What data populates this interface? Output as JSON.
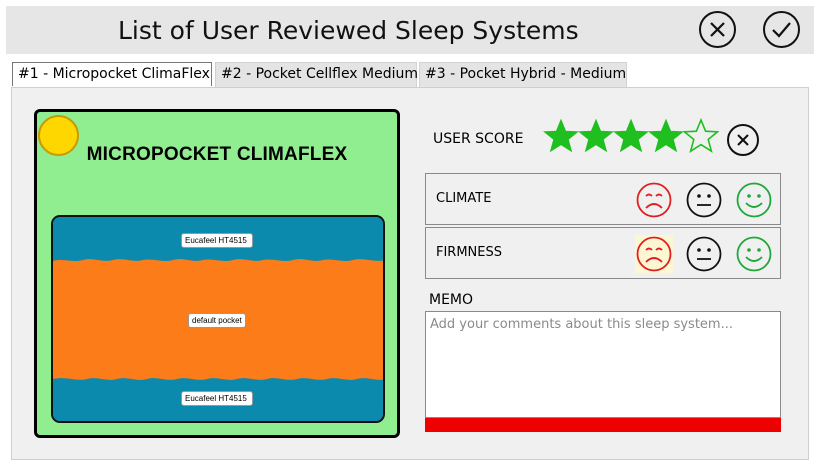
{
  "window": {
    "title": "List of User Reviewed Sleep Systems"
  },
  "tabs": [
    {
      "label": "#1 - Micropocket ClimaFlex",
      "active": true
    },
    {
      "label": "#2 - Pocket Cellflex Medium",
      "active": false
    },
    {
      "label": "#3 - Pocket Hybrid - Medium",
      "active": false
    }
  ],
  "product": {
    "title": "MICROPOCKET CLIMAFLEX",
    "layers": {
      "top": "Eucafeel HT4515",
      "middle": "default pocket",
      "bottom": "Eucafeel HT4515"
    },
    "colors": {
      "card": "#90ee90",
      "comfort_layer": "#0b8aad",
      "core_layer": "#fd7c1a",
      "sun": "#ffd700"
    }
  },
  "user_score": {
    "label": "USER SCORE",
    "rating": 4,
    "max": 5,
    "color": "#1fbf1f"
  },
  "ratings": [
    {
      "label": "CLIMATE",
      "selected": null
    },
    {
      "label": "FIRMNESS",
      "selected": "sad"
    }
  ],
  "face_colors": {
    "sad": "#e02020",
    "neutral": "#111111",
    "happy": "#1fa83a"
  },
  "memo": {
    "label": "MEMO",
    "value": "",
    "placeholder": "Add your comments about this sleep system...",
    "status_color": "#ee0000"
  },
  "icons": {
    "close": "close-circle-icon",
    "confirm": "check-circle-icon",
    "star": "star-icon",
    "clear": "clear-score-icon"
  }
}
